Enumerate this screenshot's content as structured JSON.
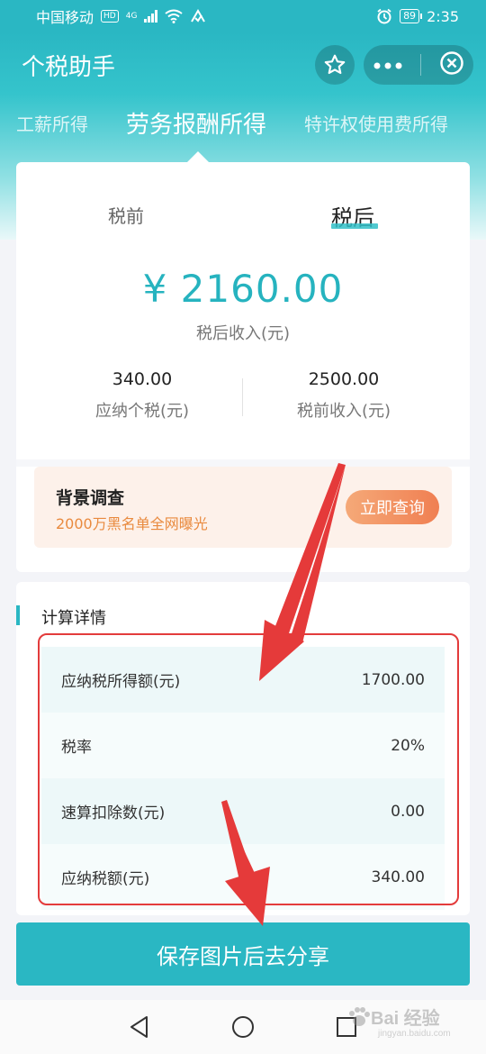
{
  "status_bar": {
    "carrier": "中国移动",
    "hd": "HD",
    "network": "4G",
    "battery": "89",
    "time": "2:35"
  },
  "header": {
    "title": "个税助手",
    "star_icon": "star-icon",
    "more_icon": "more-dots-icon",
    "close_icon": "close-circle-icon"
  },
  "income_tabs": [
    {
      "label": "工薪所得",
      "active": false
    },
    {
      "label": "劳务报酬所得",
      "active": true
    },
    {
      "label": "特许权使用费所得",
      "active": false
    }
  ],
  "mode_tabs": {
    "pre_tax": "税前",
    "after_tax": "税后",
    "active": "after_tax"
  },
  "result": {
    "amount": "¥ 2160.00",
    "amount_label": "税后收入(元)",
    "tax_value": "340.00",
    "tax_label": "应纳个税(元)",
    "pretax_value": "2500.00",
    "pretax_label": "税前收入(元)"
  },
  "promo": {
    "title": "背景调查",
    "subtitle": "2000万黑名单全网曝光",
    "button": "立即查询"
  },
  "details": {
    "heading": "计算详情",
    "rows": [
      {
        "label": "应纳税所得额(元)",
        "value": "1700.00"
      },
      {
        "label": "税率",
        "value": "20%"
      },
      {
        "label": "速算扣除数(元)",
        "value": "0.00"
      },
      {
        "label": "应纳税额(元)",
        "value": "340.00"
      }
    ]
  },
  "share_button": "保存图片后去分享",
  "colors": {
    "primary": "#2ab7c3",
    "amount": "#26b3bf",
    "promo_accent": "#f07f52",
    "annotation_red": "#e33b3b"
  },
  "watermark": {
    "text": "Bai 经验",
    "sub": "jingyan.baidu.com"
  }
}
